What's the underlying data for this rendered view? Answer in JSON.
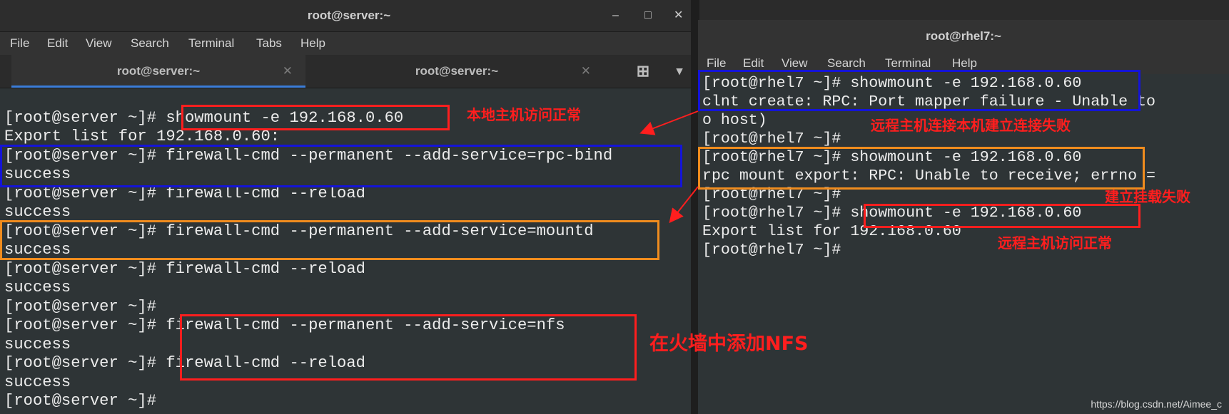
{
  "left_window": {
    "title": "root@server:~",
    "controls": [
      "–",
      "□",
      "✕"
    ],
    "menu": [
      "File",
      "Edit",
      "View",
      "Search",
      "Terminal",
      "Tabs",
      "Help"
    ],
    "tabs": [
      {
        "label": "root@server:~",
        "close": "✕"
      },
      {
        "label": "root@server:~",
        "close": "✕"
      }
    ],
    "new_tab_glyph": "⊞",
    "dropdown_glyph": "▾",
    "lines": [
      "[root@server ~]# showmount -e 192.168.0.60",
      "Export list for 192.168.0.60:",
      "[root@server ~]# firewall-cmd --permanent --add-service=rpc-bind",
      "success",
      "[root@server ~]# firewall-cmd --reload",
      "success",
      "[root@server ~]# firewall-cmd --permanent --add-service=mountd",
      "success",
      "[root@server ~]# firewall-cmd --reload",
      "success",
      "[root@server ~]#",
      "[root@server ~]# firewall-cmd --permanent --add-service=nfs",
      "success",
      "[root@server ~]# firewall-cmd --reload",
      "success",
      "[root@server ~]#"
    ]
  },
  "right_window": {
    "title": "root@rhel7:~",
    "menu": [
      "File",
      "Edit",
      "View",
      "Search",
      "Terminal",
      "Help"
    ],
    "lines": [
      "[root@rhel7 ~]# showmount -e 192.168.0.60",
      "clnt create: RPC: Port mapper failure - Unable to",
      "o host)",
      "[root@rhel7 ~]#",
      "[root@rhel7 ~]# showmount -e 192.168.0.60",
      "rpc mount export: RPC: Unable to receive; errno =",
      "[root@rhel7 ~]#",
      "[root@rhel7 ~]# showmount -e 192.168.0.60",
      "Export list for 192.168.0.60",
      "[root@rhel7 ~]#"
    ]
  },
  "annotations": {
    "local_ok": "本地主机访问正常",
    "remote_fail_connect": "远程主机连接本机建立连接失败",
    "mount_fail": "建立挂载失败",
    "remote_ok": "远程主机访问正常",
    "add_nfs": "在火墙中添加NFS"
  },
  "colors": {
    "red": "#ff1e1e",
    "blue": "#1414d8",
    "orange": "#f08c1e",
    "terminal_bg": "#2e3436",
    "tab_accent": "#3b7dd8"
  },
  "watermark": "https://blog.csdn.net/Aimee_c"
}
